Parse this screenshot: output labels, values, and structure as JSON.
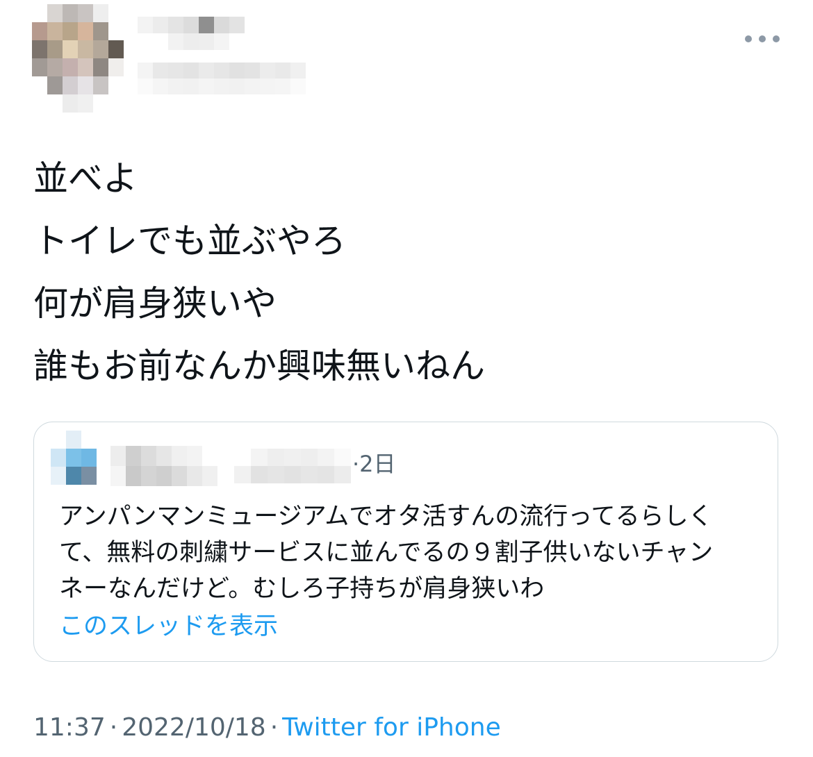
{
  "tweet": {
    "author": {
      "avatar": "pixelated-avatar",
      "display_name": "",
      "handle": ""
    },
    "more_icon": "more-horizontal-icon",
    "lines": [
      "並べよ",
      "トイレでも並ぶやろ",
      "何が肩身狭いや",
      "誰もお前なんか興味無いねん"
    ],
    "quoted": {
      "avatar": "pixelated-avatar",
      "time": "·2日",
      "lines": [
        "アンパンマンミュージアムでオタ活すんの流行ってるらしく",
        "て、無料の刺繍サービスに並んでるの９割子供いないチャン",
        "ネーなんだけど。むしろ子持ちが肩身狭いわ"
      ],
      "show_thread": "このスレッドを表示"
    },
    "time": "11:37",
    "date": "2022/10/18",
    "separator": "·",
    "source": "Twitter for iPhone"
  },
  "colors": {
    "text": "#0f1419",
    "secondary": "#536471",
    "link": "#1d9bf0",
    "border": "#cfd9de"
  }
}
